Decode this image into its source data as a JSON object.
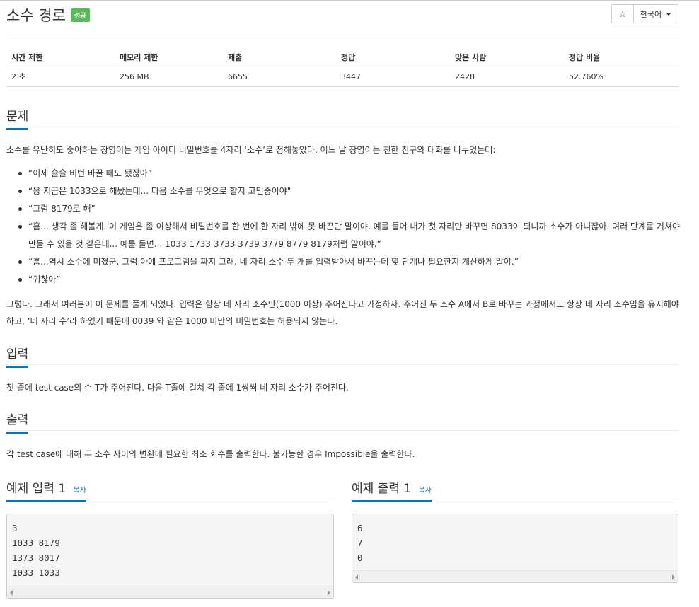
{
  "problem": {
    "title": "소수 경로",
    "status_badge": "성공"
  },
  "header_buttons": {
    "star_icon": "star-icon",
    "star_glyph": "☆",
    "language": "한국어"
  },
  "info_table": {
    "headers": [
      "시간 제한",
      "메모리 제한",
      "제출",
      "정답",
      "맞은 사람",
      "정답 비율"
    ],
    "values": [
      "2 초",
      "256 MB",
      "6655",
      "3447",
      "2428",
      "52.760%"
    ]
  },
  "sections": {
    "problem_label": "문제",
    "input_label": "입력",
    "output_label": "출력"
  },
  "problem_text": {
    "intro": "소수를 유난히도 좋아하는 창영이는 게임 아이디 비밀번호를 4자리 ‘소수’로 정해놓았다. 어느 날 창영이는 친한 친구와 대화를 나누었는데:",
    "quotes": [
      "“이제 슬슬 비번 바꿀 때도 됐잖아”",
      "“응 지금은 1033으로 해놨는데... 다음 소수를 무엇으로 할지 고민중이야\"",
      "“그럼 8179로 해”",
      "“흠... 생각 좀 해볼게. 이 게임은 좀 이상해서 비밀번호를 한 번에 한 자리 밖에 못 바꾼단 말이야. 예를 들어 내가 첫 자리만 바꾸면 8033이 되니까 소수가 아니잖아. 여러 단계를 거쳐야 만들 수 있을 것 같은데... 예를 들면... 1033 1733 3733 3739 3779 8779 8179처럼 말이야.”",
      "“흠...역시 소수에 미쳤군. 그럼 아예 프로그램을 짜지 그래. 네 자리 소수 두 개를 입력받아서 바꾸는데 몇 단계나 필요한지 계산하게 말야.”",
      "“귀찮아”"
    ],
    "closing": "그렇다. 그래서 여러분이 이 문제를 풀게 되었다. 입력은 항상 네 자리 소수만(1000 이상) 주어진다고 가정하자. 주어진 두 소수 A에서 B로 바꾸는 과정에서도 항상 네 자리 소수임을 유지해야 하고, ‘네 자리 수’라 하였기 때문에 0039 와 같은 1000 미만의 비밀번호는 허용되지 않는다."
  },
  "input_text": "첫 줄에 test case의 수 T가 주어진다. 다음 T줄에 걸쳐 각 줄에 1쌍씩 네 자리 소수가 주어진다.",
  "output_text": "각 test case에 대해 두 소수 사이의 변환에 필요한 최소 회수를 출력한다. 불가능한 경우 Impossible을 출력한다.",
  "samples": {
    "input_label": "예제 입력 1",
    "output_label": "예제 출력 1",
    "copy_label": "복사",
    "input_lines": [
      "3",
      "1033 8179",
      "1373 8017",
      "1033 1033"
    ],
    "output_lines": [
      "6",
      "7",
      "0"
    ]
  }
}
